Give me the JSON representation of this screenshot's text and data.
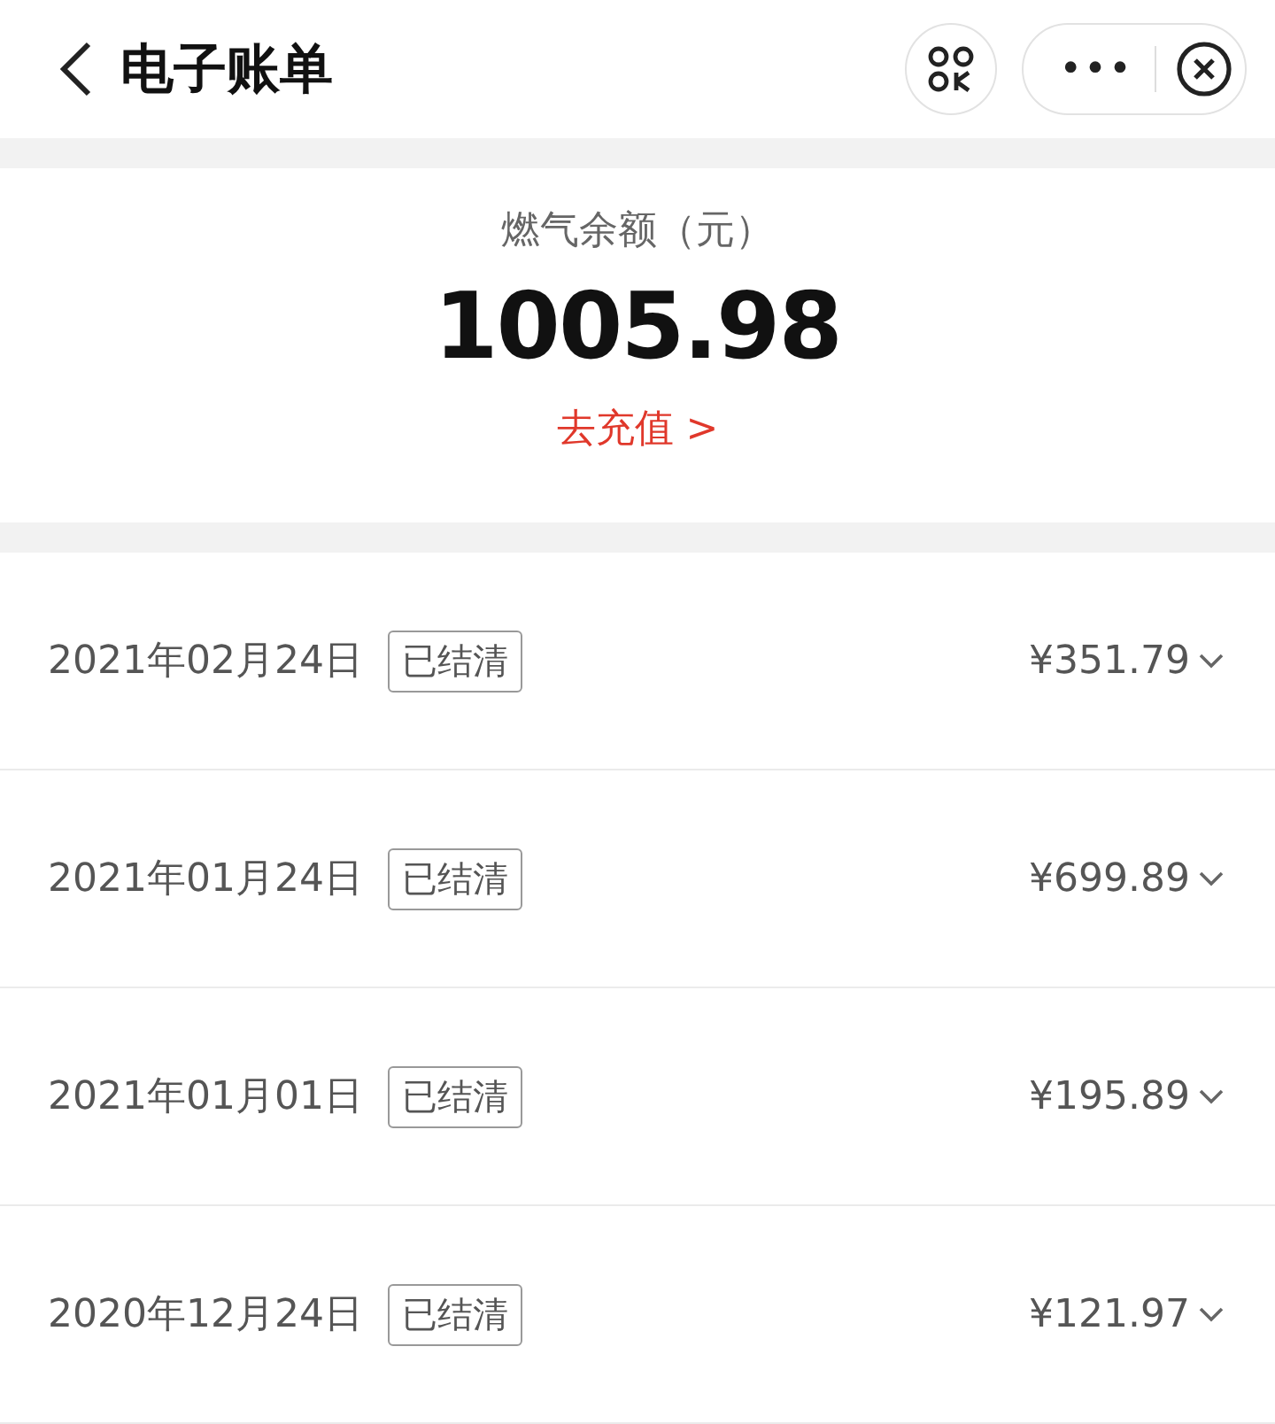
{
  "header": {
    "title": "电子账单",
    "menu_dots": "•••"
  },
  "balance": {
    "label": "燃气余额（元）",
    "amount": "1005.98",
    "recharge_link": "去充值 >"
  },
  "bills": [
    {
      "date": "2021年02月24日",
      "status": "已结清",
      "amount": "¥351.79"
    },
    {
      "date": "2021年01月24日",
      "status": "已结清",
      "amount": "¥699.89"
    },
    {
      "date": "2021年01月01日",
      "status": "已结清",
      "amount": "¥195.89"
    },
    {
      "date": "2020年12月24日",
      "status": "已结清",
      "amount": "¥121.97"
    }
  ]
}
